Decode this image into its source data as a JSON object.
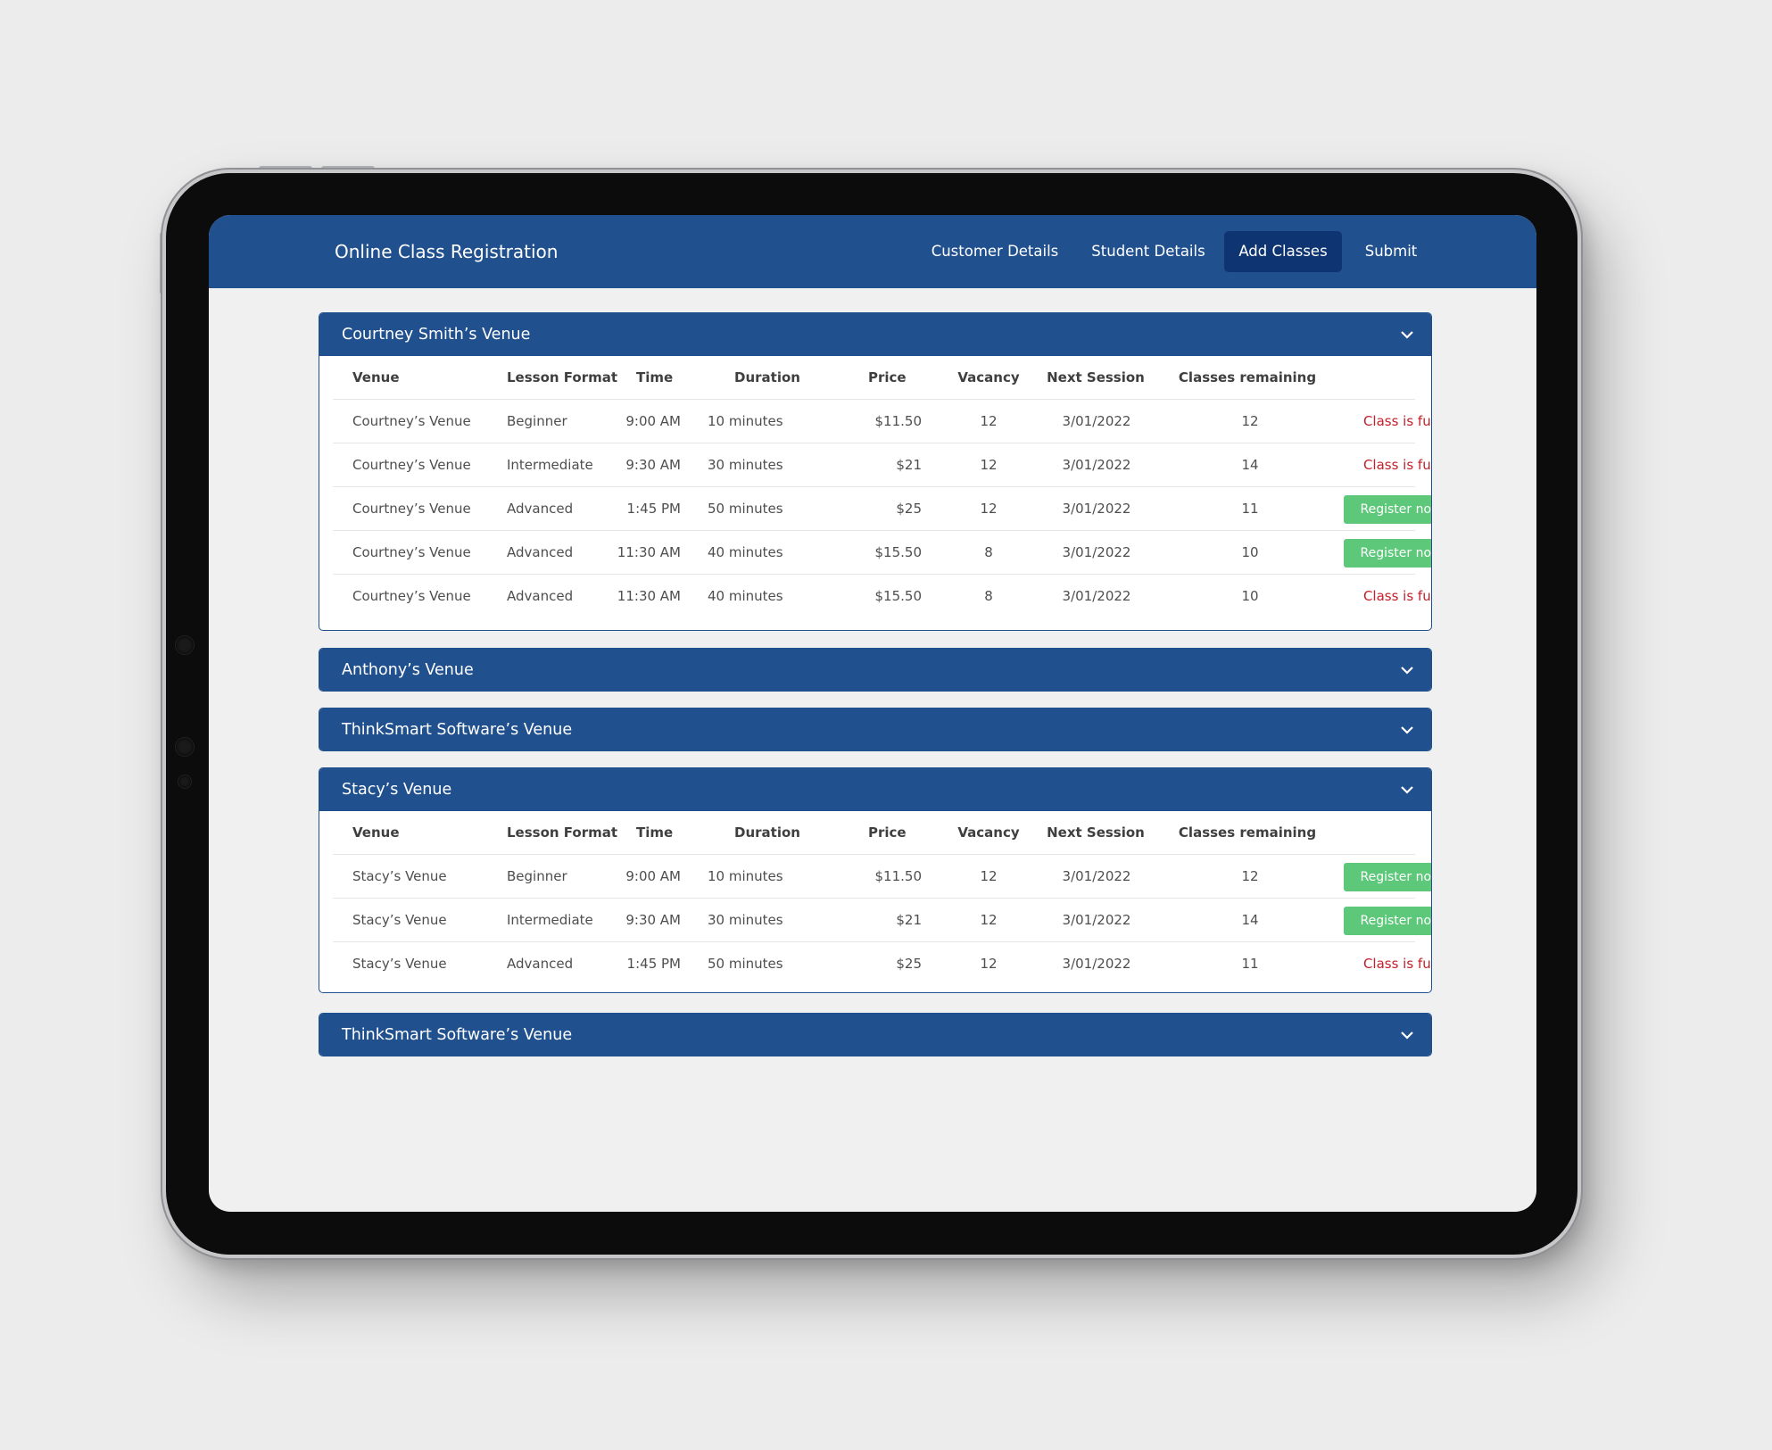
{
  "app": {
    "title": "Online Class Registration",
    "nav": [
      {
        "label": "Customer Details",
        "active": false
      },
      {
        "label": "Student Details",
        "active": false
      },
      {
        "label": "Add Classes",
        "active": true
      },
      {
        "label": "Submit",
        "active": false
      }
    ]
  },
  "columns": [
    "Venue",
    "Lesson Format",
    "Time",
    "Duration",
    "Price",
    "Vacancy",
    "Next Session",
    "Classes remaining"
  ],
  "status_labels": {
    "full": "Class is full",
    "register": "Register now"
  },
  "colors": {
    "header_blue": "#21508f",
    "active_nav": "#0f3472",
    "register_green": "#5dc77a",
    "full_red": "#c4202a"
  },
  "icons": {
    "accordion": "chevron-down-icon"
  },
  "venues": [
    {
      "title": "Courtney Smith’s Venue",
      "expanded": true,
      "rows": [
        {
          "venue": "Courtney’s Venue",
          "format": "Beginner",
          "time": "9:00 AM",
          "duration": "10 minutes",
          "price": "$11.50",
          "vacancy": "12",
          "next_session": "3/01/2022",
          "remaining": "12",
          "status": "full"
        },
        {
          "venue": "Courtney’s Venue",
          "format": "Intermediate",
          "time": "9:30 AM",
          "duration": "30 minutes",
          "price": "$21",
          "vacancy": "12",
          "next_session": "3/01/2022",
          "remaining": "14",
          "status": "full"
        },
        {
          "venue": "Courtney’s Venue",
          "format": "Advanced",
          "time": "1:45 PM",
          "duration": "50 minutes",
          "price": "$25",
          "vacancy": "12",
          "next_session": "3/01/2022",
          "remaining": "11",
          "status": "register"
        },
        {
          "venue": "Courtney’s Venue",
          "format": "Advanced",
          "time": "11:30 AM",
          "duration": "40 minutes",
          "price": "$15.50",
          "vacancy": "8",
          "next_session": "3/01/2022",
          "remaining": "10",
          "status": "register"
        },
        {
          "venue": "Courtney’s Venue",
          "format": "Advanced",
          "time": "11:30 AM",
          "duration": "40 minutes",
          "price": "$15.50",
          "vacancy": "8",
          "next_session": "3/01/2022",
          "remaining": "10",
          "status": "full"
        }
      ]
    },
    {
      "title": "Anthony’s Venue",
      "expanded": false,
      "rows": []
    },
    {
      "title": "ThinkSmart Software’s Venue",
      "expanded": false,
      "rows": []
    },
    {
      "title": "Stacy’s Venue",
      "expanded": true,
      "rows": [
        {
          "venue": "Stacy’s Venue",
          "format": "Beginner",
          "time": "9:00 AM",
          "duration": "10 minutes",
          "price": "$11.50",
          "vacancy": "12",
          "next_session": "3/01/2022",
          "remaining": "12",
          "status": "register"
        },
        {
          "venue": "Stacy’s Venue",
          "format": "Intermediate",
          "time": "9:30 AM",
          "duration": "30 minutes",
          "price": "$21",
          "vacancy": "12",
          "next_session": "3/01/2022",
          "remaining": "14",
          "status": "register"
        },
        {
          "venue": "Stacy’s Venue",
          "format": "Advanced",
          "time": "1:45 PM",
          "duration": "50 minutes",
          "price": "$25",
          "vacancy": "12",
          "next_session": "3/01/2022",
          "remaining": "11",
          "status": "full"
        }
      ]
    },
    {
      "title": "ThinkSmart Software’s Venue",
      "expanded": false,
      "rows": []
    }
  ]
}
